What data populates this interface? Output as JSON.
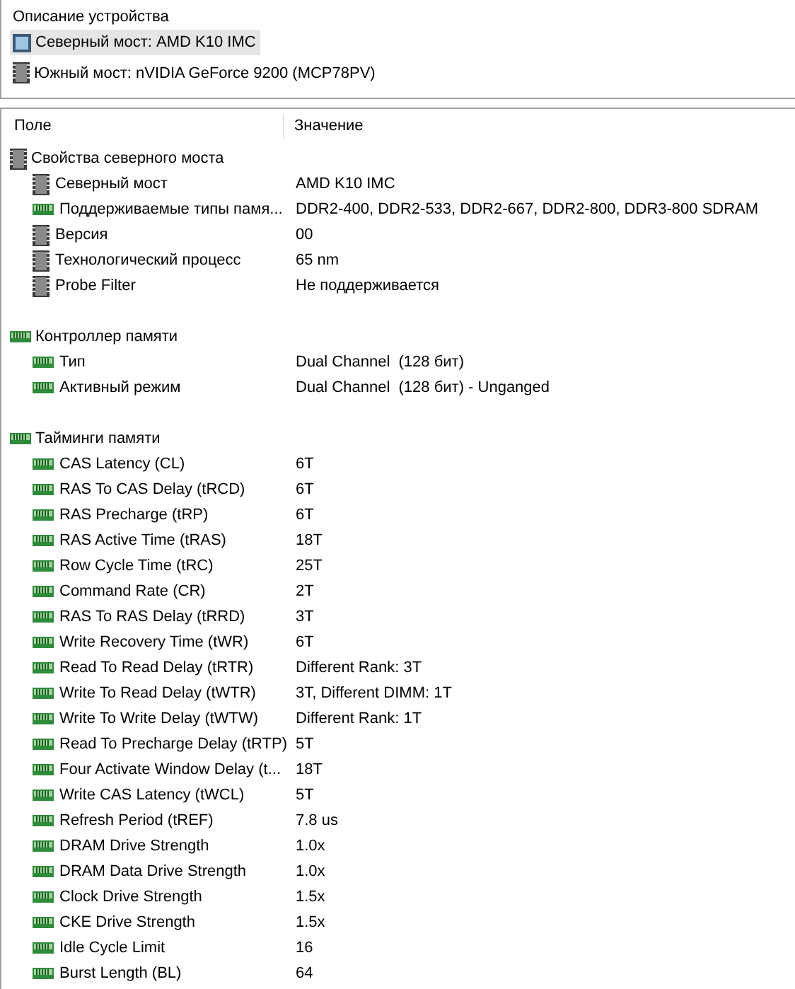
{
  "device_panel": {
    "title": "Описание устройства",
    "devices": [
      {
        "label": "Северный мост: AMD K10 IMC",
        "kind": "cpu",
        "selected": true
      },
      {
        "label": "Южный мост: nVIDIA GeForce 9200 (MCP78PV)",
        "kind": "chip",
        "selected": false
      }
    ]
  },
  "table": {
    "columns": [
      "Поле",
      "Значение"
    ],
    "groups": [
      {
        "label": "Свойства северного моста",
        "kind": "chip",
        "rows": [
          {
            "field": "Северный мост",
            "value": "AMD K10 IMC",
            "kind": "chip"
          },
          {
            "field": "Поддерживаемые типы памя...",
            "value": "DDR2-400, DDR2-533, DDR2-667, DDR2-800, DDR3-800 SDRAM",
            "kind": "ram"
          },
          {
            "field": "Версия",
            "value": "00",
            "kind": "chip"
          },
          {
            "field": "Технологический процесс",
            "value": "65 nm",
            "kind": "chip"
          },
          {
            "field": "Probe Filter",
            "value": "Не поддерживается",
            "kind": "chip"
          }
        ]
      },
      {
        "label": "Контроллер памяти",
        "kind": "ram",
        "rows": [
          {
            "field": "Тип",
            "value": "Dual Channel  (128 бит)",
            "kind": "ram"
          },
          {
            "field": "Активный режим",
            "value": "Dual Channel  (128 бит) - Unganged",
            "kind": "ram"
          }
        ]
      },
      {
        "label": "Тайминги памяти",
        "kind": "ram",
        "rows": [
          {
            "field": "CAS Latency (CL)",
            "value": "6T",
            "kind": "ram"
          },
          {
            "field": "RAS To CAS Delay (tRCD)",
            "value": "6T",
            "kind": "ram"
          },
          {
            "field": "RAS Precharge (tRP)",
            "value": "6T",
            "kind": "ram"
          },
          {
            "field": "RAS Active Time (tRAS)",
            "value": "18T",
            "kind": "ram"
          },
          {
            "field": "Row Cycle Time (tRC)",
            "value": "25T",
            "kind": "ram"
          },
          {
            "field": "Command Rate (CR)",
            "value": "2T",
            "kind": "ram"
          },
          {
            "field": "RAS To RAS Delay (tRRD)",
            "value": "3T",
            "kind": "ram"
          },
          {
            "field": "Write Recovery Time (tWR)",
            "value": "6T",
            "kind": "ram"
          },
          {
            "field": "Read To Read Delay (tRTR)",
            "value": "Different Rank: 3T",
            "kind": "ram"
          },
          {
            "field": "Write To Read Delay (tWTR)",
            "value": "3T, Different DIMM: 1T",
            "kind": "ram"
          },
          {
            "field": "Write To Write Delay (tWTW)",
            "value": "Different Rank: 1T",
            "kind": "ram"
          },
          {
            "field": "Read To Precharge Delay (tRTP)",
            "value": "5T",
            "kind": "ram"
          },
          {
            "field": "Four Activate Window Delay (t...",
            "value": "18T",
            "kind": "ram"
          },
          {
            "field": "Write CAS Latency (tWCL)",
            "value": "5T",
            "kind": "ram"
          },
          {
            "field": "Refresh Period (tREF)",
            "value": "7.8 us",
            "kind": "ram"
          },
          {
            "field": "DRAM Drive Strength",
            "value": "1.0x",
            "kind": "ram"
          },
          {
            "field": "DRAM Data Drive Strength",
            "value": "1.0x",
            "kind": "ram"
          },
          {
            "field": "Clock Drive Strength",
            "value": "1.5x",
            "kind": "ram"
          },
          {
            "field": "CKE Drive Strength",
            "value": "1.5x",
            "kind": "ram"
          },
          {
            "field": "Idle Cycle Limit",
            "value": "16",
            "kind": "ram"
          },
          {
            "field": "Burst Length (BL)",
            "value": "64",
            "kind": "ram"
          }
        ]
      }
    ]
  }
}
